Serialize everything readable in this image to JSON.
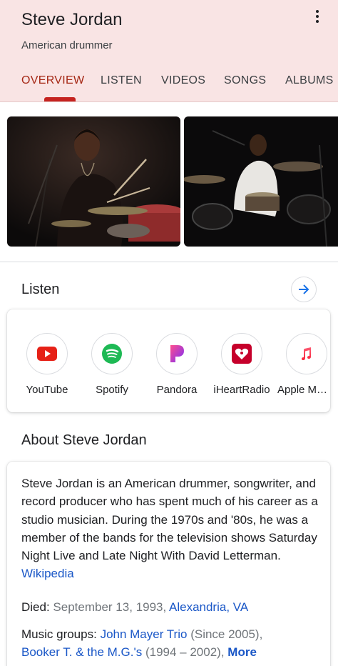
{
  "header": {
    "title": "Steve Jordan",
    "subtitle": "American drummer",
    "tabs": [
      {
        "label": "OVERVIEW"
      },
      {
        "label": "LISTEN"
      },
      {
        "label": "VIDEOS"
      },
      {
        "label": "SONGS"
      },
      {
        "label": "ALBUMS"
      }
    ],
    "active_tab": "OVERVIEW",
    "accent_color": "#a52714",
    "background_color": "#f9e4e4"
  },
  "photos": [
    {
      "description_icon": "drummer-photo-1"
    },
    {
      "description_icon": "drummer-photo-2"
    }
  ],
  "listen": {
    "title": "Listen",
    "services": [
      {
        "label": "YouTube",
        "icon": "youtube-icon"
      },
      {
        "label": "Spotify",
        "icon": "spotify-icon"
      },
      {
        "label": "Pandora",
        "icon": "pandora-icon"
      },
      {
        "label": "iHeartRadio",
        "icon": "iheartradio-icon"
      },
      {
        "label": "Apple Music",
        "icon": "apple-music-icon"
      }
    ]
  },
  "about": {
    "title": "About Steve Jordan",
    "description": "Steve Jordan is an American drummer, songwriter, and record producer who has spent much of his career as a studio musician. During the 1970s and '80s, he was a member of the bands for the television shows Saturday Night Live and Late Night With David Letterman.",
    "source_link": "Wikipedia",
    "died": {
      "label": "Died:",
      "date": "September 13, 1993,",
      "place": "Alexandria, VA"
    },
    "music_groups": {
      "label": "Music groups:",
      "group1": "John Mayer Trio",
      "group1_years": "(Since 2005),",
      "group2": "Booker T. & the M.G.'s",
      "group2_years": "(1994 – 2002),",
      "more": "More"
    }
  }
}
